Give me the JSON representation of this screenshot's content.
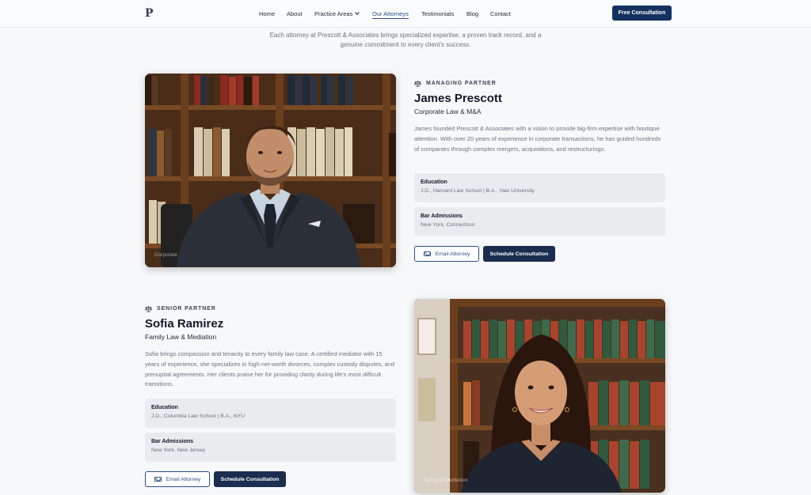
{
  "nav": {
    "logo": "P",
    "links": [
      {
        "label": "Home"
      },
      {
        "label": "About"
      },
      {
        "label": "Practice Areas"
      },
      {
        "label": "Our Attorneys"
      },
      {
        "label": "Testimonials"
      },
      {
        "label": "Blog"
      },
      {
        "label": "Contact"
      }
    ],
    "active": "Our Attorneys",
    "cta": "Free Consultation"
  },
  "intro": "Each attorney at Prescott & Associates brings specialized expertise, a proven track record, and a genuine commitment to every client's success.",
  "attorneys": [
    {
      "role": "MANAGING PARTNER",
      "name": "James Prescott",
      "practice": "Corporate Law & M&A",
      "bio": "James founded Prescott & Associates with a vision to provide big-firm expertise with boutique attention. With over 20 years of experience in corporate transactions, he has guided hundreds of companies through complex mergers, acquisitions, and restructurings.",
      "education_label": "Education",
      "education": "J.D., Harvard Law School | B.A., Yale University",
      "bar_label": "Bar Admissions",
      "bar": "New York, Connecticut",
      "email_button": "Email Attorney",
      "schedule_button": "Schedule Consultation",
      "photo_caption": "Corporate"
    },
    {
      "role": "SENIOR PARTNER",
      "name": "Sofia Ramirez",
      "practice": "Family Law & Mediation",
      "bio": "Sofia brings compassion and tenacity to every family law case. A certified mediator with 15 years of experience, she specializes in high-net-worth divorces, complex custody disputes, and prenuptial agreements. Her clients praise her for providing clarity during life's most difficult transitions.",
      "education_label": "Education",
      "education": "J.D., Columbia Law School | B.A., NYU",
      "bar_label": "Bar Admissions",
      "bar": "New York, New Jersey",
      "email_button": "Email Attorney",
      "schedule_button": "Schedule Consultation",
      "photo_caption": "Family & Mediation"
    }
  ],
  "colors": {
    "accent": "#2a4f86",
    "dark": "#14325f",
    "background": "#f7f8fa"
  },
  "icons": {
    "role": "scales-of-justice-icon",
    "email": "envelope-icon",
    "dropdown": "chevron-down-icon"
  }
}
